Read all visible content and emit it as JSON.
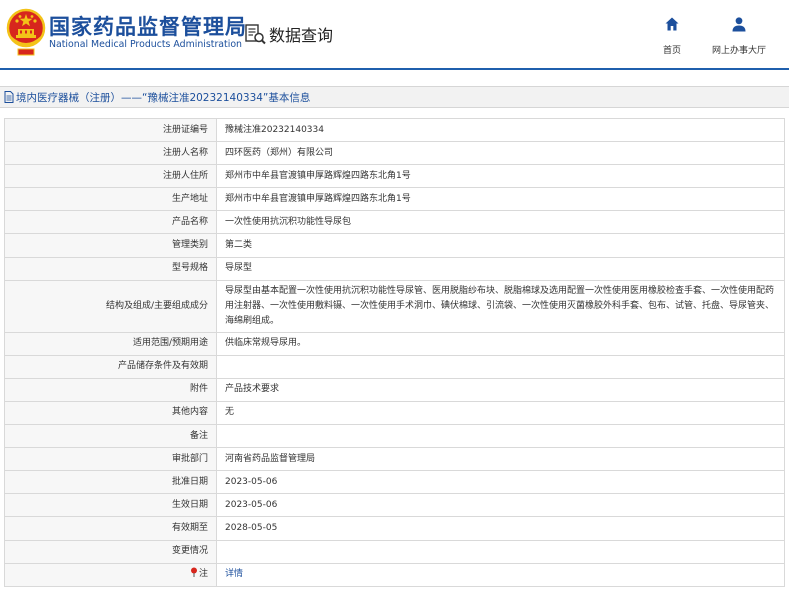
{
  "header": {
    "org_name_cn": "国家药品监督管理局",
    "org_name_en": "National Medical Products Administration",
    "query_label": "数据查询",
    "nav_home": "首页",
    "nav_office": "网上办事大厅"
  },
  "title_bar": {
    "text": "境内医疗器械（注册）——“豫械注准20232140334”基本信息"
  },
  "rows": [
    {
      "label": "注册证编号",
      "value": "豫械注准20232140334"
    },
    {
      "label": "注册人名称",
      "value": "四环医药（郑州）有限公司"
    },
    {
      "label": "注册人住所",
      "value": "郑州市中牟县官渡镇申厚路辉煌四路东北角1号"
    },
    {
      "label": "生产地址",
      "value": "郑州市中牟县官渡镇申厚路辉煌四路东北角1号"
    },
    {
      "label": "产品名称",
      "value": "一次性使用抗沉积功能性导尿包"
    },
    {
      "label": "管理类别",
      "value": "第二类"
    },
    {
      "label": "型号规格",
      "value": "导尿型"
    },
    {
      "label": "结构及组成/主要组成成分",
      "value": "导尿型由基本配置一次性使用抗沉积功能性导尿管、医用脱脂纱布块、脱脂棉球及选用配置一次性使用医用橡胶检查手套、一次性使用配药用注射器、一次性使用敷料镊、一次性使用手术洞巾、碘伏棉球、引流袋、一次性使用灭菌橡胶外科手套、包布、试管、托盘、导尿管夹、海绵刷组成。"
    },
    {
      "label": "适用范围/预期用途",
      "value": "供临床常规导尿用。"
    },
    {
      "label": "产品储存条件及有效期",
      "value": ""
    },
    {
      "label": "附件",
      "value": "产品技术要求"
    },
    {
      "label": "其他内容",
      "value": "无"
    },
    {
      "label": "备注",
      "value": ""
    },
    {
      "label": "审批部门",
      "value": "河南省药品监督管理局"
    },
    {
      "label": "批准日期",
      "value": "2023-05-06"
    },
    {
      "label": "生效日期",
      "value": "2023-05-06"
    },
    {
      "label": "有效期至",
      "value": "2028-05-05"
    },
    {
      "label": "变更情况",
      "value": ""
    },
    {
      "label": "注",
      "value": "详情"
    }
  ],
  "colors": {
    "brand_blue": "#1c4f9c",
    "emblem_red": "#d7261d",
    "emblem_gold": "#f3c318"
  },
  "icons": {
    "emblem": "national-emblem-icon",
    "query": "search-document-icon",
    "home": "home-icon",
    "office": "user-icon",
    "title": "document-icon",
    "note": "pin-icon"
  }
}
